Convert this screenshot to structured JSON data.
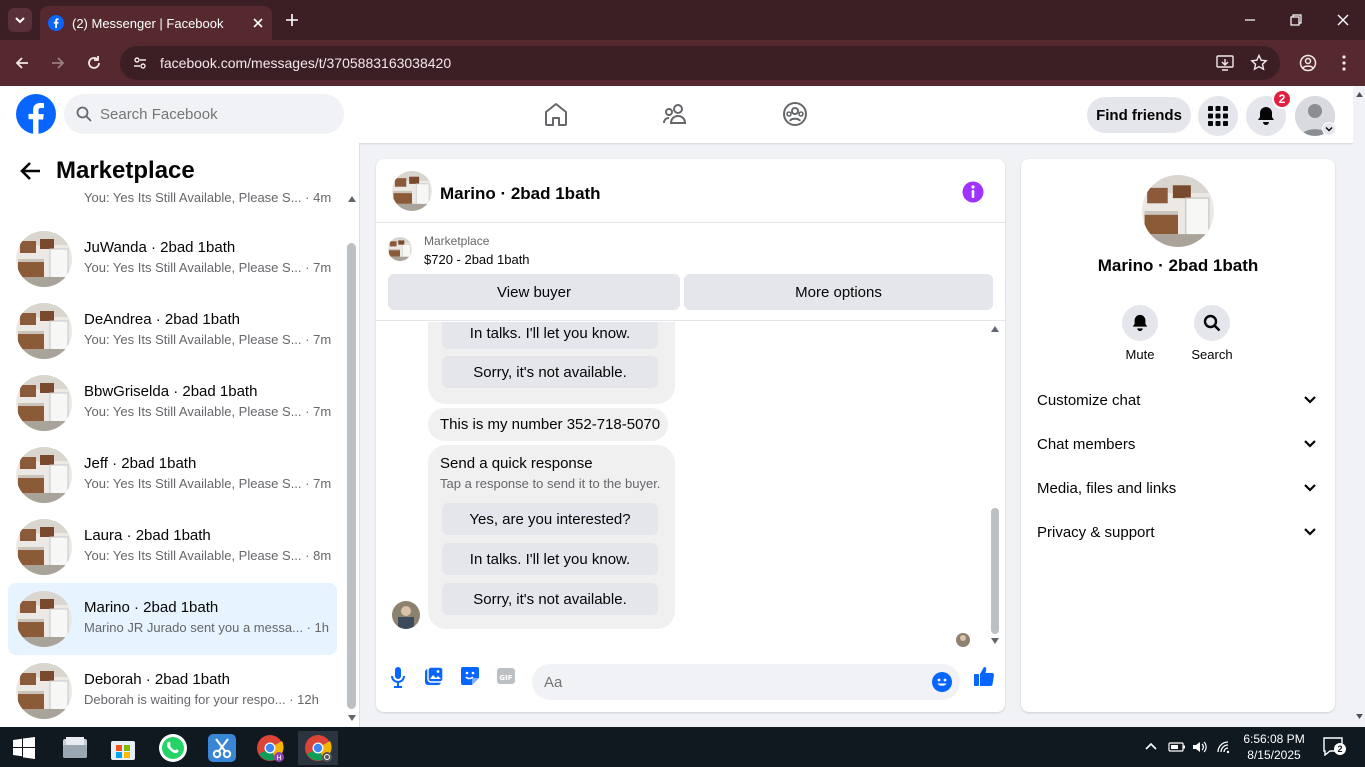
{
  "browser": {
    "tab_title": "(2) Messenger | Facebook",
    "url": "facebook.com/messages/t/3705883163038420"
  },
  "fb_header": {
    "search_placeholder": "Search Facebook",
    "find_friends_label": "Find friends",
    "notification_count": "2"
  },
  "sidebar": {
    "title": "Marketplace",
    "conversations": [
      {
        "name": "",
        "preview": "You: Yes Its Still Available, Please S...",
        "time": "· 4m"
      },
      {
        "name": "JuWanda · 2bad 1bath",
        "preview": "You: Yes Its Still Available, Please S...",
        "time": "· 7m"
      },
      {
        "name": "DeAndrea · 2bad 1bath",
        "preview": "You: Yes Its Still Available, Please S...",
        "time": "· 7m"
      },
      {
        "name": "BbwGriselda · 2bad 1bath",
        "preview": "You: Yes Its Still Available, Please S...",
        "time": "· 7m"
      },
      {
        "name": "Jeff · 2bad 1bath",
        "preview": "You: Yes Its Still Available, Please S...",
        "time": "· 7m"
      },
      {
        "name": "Laura · 2bad 1bath",
        "preview": "You: Yes Its Still Available, Please S...",
        "time": "· 8m"
      },
      {
        "name": "Marino · 2bad 1bath",
        "preview": "Marino JR Jurado sent you a messa...",
        "time": "· 1h"
      },
      {
        "name": "Deborah · 2bad 1bath",
        "preview": "Deborah is waiting for your respo...",
        "time": "· 12h"
      }
    ]
  },
  "chat": {
    "title": "Marino · 2bad 1bath",
    "listing_source": "Marketplace",
    "listing_title": "$720 - 2bad 1bath",
    "view_buyer_label": "View buyer",
    "more_options_label": "More options",
    "top_quick_replies": [
      "In talks. I'll let you know.",
      "Sorry, it's not available."
    ],
    "number_message": "This is my number 352-718-5070",
    "quick_response_title": "Send a quick response",
    "quick_response_subtitle": "Tap a response to send it to the buyer.",
    "quick_replies": [
      "Yes, are you interested?",
      "In talks. I'll let you know.",
      "Sorry, it's not available."
    ],
    "composer_placeholder": "Aa"
  },
  "right_panel": {
    "name": "Marino · 2bad 1bath",
    "mute_label": "Mute",
    "search_label": "Search",
    "sections": [
      "Customize chat",
      "Chat members",
      "Media, files and links",
      "Privacy & support"
    ]
  },
  "taskbar": {
    "time": "6:56:08 PM",
    "date": "8/15/2025",
    "notification_count": "2"
  },
  "colors": {
    "fb_blue": "#0866ff",
    "messenger_purple": "#a033ff",
    "chrome_tab_bg": "#3c1f25",
    "chrome_toolbar_bg": "#55292f",
    "active_conversation_bg": "#e7f3ff",
    "notification_red": "#e41e3f"
  }
}
